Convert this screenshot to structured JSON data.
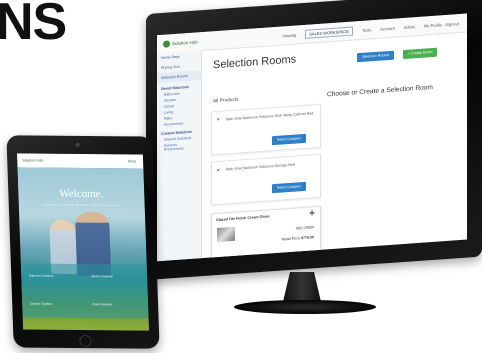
{
  "headline": "NS",
  "monitor": {
    "app_logo": "Solution Hub",
    "topnav": {
      "viewing_label": "Viewing",
      "viewing_value": "SALES WORKSPACE",
      "items": [
        "Tools",
        "Account",
        "Admin"
      ],
      "user": "My Profile · Signout"
    },
    "sidebar": {
      "items": [
        "Home Page",
        "Pricing Tool",
        "Selection Rooms"
      ],
      "section": "Saved Solutions",
      "sub_items": [
        "Bathroom",
        "Kitchen",
        "Closet",
        "Living",
        "Patio",
        "Accessories"
      ],
      "bottom_items": [
        "Curated Solutions",
        "Shared Solutions",
        "Solution Preferences"
      ]
    },
    "page_title": "Selection Rooms",
    "buttons": {
      "selection_rooms": "Selection Rooms",
      "create_room": "+ Create Room"
    },
    "all_products_label": "All Products",
    "prompt": "Choose or Create a Selection Room",
    "cards": [
      {
        "title": "Bath Sink Bathroom Solutions Sink Vanity Cabinet Bed",
        "button": "Select Category"
      },
      {
        "title": "Bath Sink Bathroom Solutions Storage Bed",
        "button": "Select Category"
      }
    ],
    "product": {
      "name": "Glazed Tile Finish Cream Gloss",
      "sku": "SKU 20634",
      "price_label": "Retail Price",
      "price": "$775.00"
    }
  },
  "tablet": {
    "brand": "Solution Hub",
    "header_right": "Shop ·",
    "welcome": "Welcome.",
    "welcome_sub": "Let us help you plan the right home solution for every room.",
    "tiles": [
      "Bathroom Solutions",
      "Kitchen Solutions",
      "Outdoor Solutions",
      "Closet Solutions"
    ]
  },
  "colors": {
    "accent_blue": "#2f7fc8",
    "accent_green": "#4caf50",
    "brand_green": "#3e8e3e"
  }
}
